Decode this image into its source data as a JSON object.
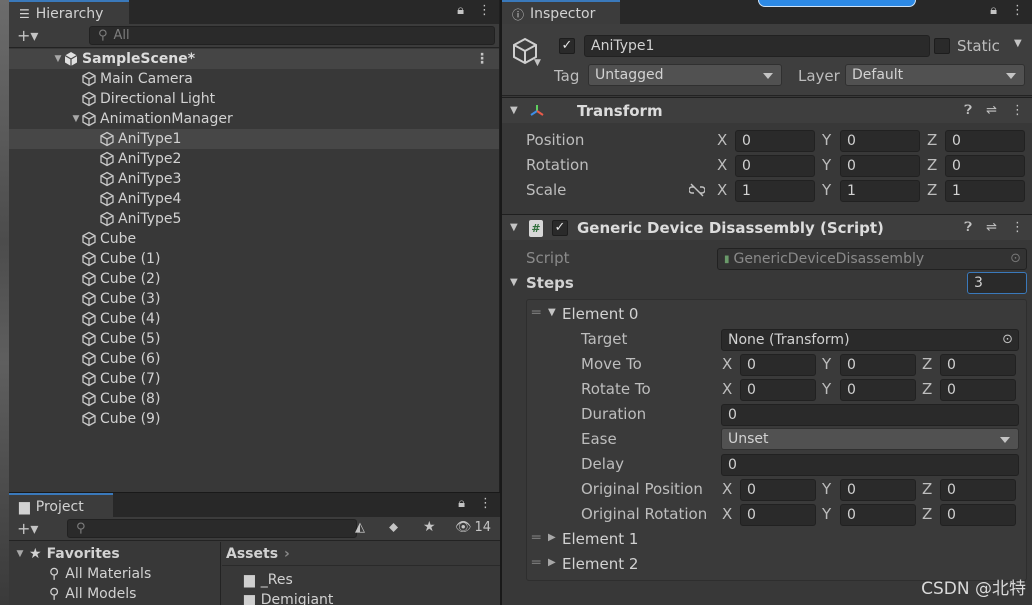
{
  "hierarchy": {
    "tab_label": "Hierarchy",
    "search_placeholder": "All",
    "scene_name": "SampleScene*",
    "items": [
      {
        "label": "Main Camera"
      },
      {
        "label": "Directional Light"
      },
      {
        "label": "AnimationManager"
      },
      {
        "label": "AniType1"
      },
      {
        "label": "AniType2"
      },
      {
        "label": "AniType3"
      },
      {
        "label": "AniType4"
      },
      {
        "label": "AniType5"
      },
      {
        "label": "Cube"
      },
      {
        "label": "Cube (1)"
      },
      {
        "label": "Cube (2)"
      },
      {
        "label": "Cube (3)"
      },
      {
        "label": "Cube (4)"
      },
      {
        "label": "Cube (5)"
      },
      {
        "label": "Cube (6)"
      },
      {
        "label": "Cube (7)"
      },
      {
        "label": "Cube (8)"
      },
      {
        "label": "Cube (9)"
      }
    ]
  },
  "project": {
    "tab_label": "Project",
    "hidden_count": "14",
    "favorites_label": "Favorites",
    "favorites": [
      "All Materials",
      "All Models"
    ],
    "assets_label": "Assets",
    "folders": [
      "_Res",
      "Demigiant"
    ]
  },
  "inspector": {
    "tab_label": "Inspector",
    "object_name": "AniType1",
    "static_label": "Static",
    "tag_label": "Tag",
    "tag_value": "Untagged",
    "layer_label": "Layer",
    "layer_value": "Default",
    "transform": {
      "title": "Transform",
      "position_label": "Position",
      "rotation_label": "Rotation",
      "scale_label": "Scale",
      "axis_x": "X",
      "axis_y": "Y",
      "axis_z": "Z",
      "position": [
        "0",
        "0",
        "0"
      ],
      "rotation": [
        "0",
        "0",
        "0"
      ],
      "scale": [
        "1",
        "1",
        "1"
      ]
    },
    "script_component": {
      "title": "Generic Device Disassembly (Script)",
      "script_label": "Script",
      "script_value": "GenericDeviceDisassembly",
      "steps_label": "Steps",
      "steps_count": "3",
      "element0_label": "Element 0",
      "target_label": "Target",
      "target_value": "None (Transform)",
      "move_to_label": "Move To",
      "move_to": [
        "0",
        "0",
        "0"
      ],
      "rotate_to_label": "Rotate To",
      "rotate_to": [
        "0",
        "0",
        "0"
      ],
      "duration_label": "Duration",
      "duration_value": "0",
      "ease_label": "Ease",
      "ease_value": "Unset",
      "delay_label": "Delay",
      "delay_value": "0",
      "orig_pos_label": "Original Position",
      "orig_pos": [
        "0",
        "0",
        "0"
      ],
      "orig_rot_label": "Original Rotation",
      "orig_rot": [
        "0",
        "0",
        "0"
      ],
      "element1_label": "Element 1",
      "element2_label": "Element 2"
    }
  },
  "watermark": "CSDN @北特"
}
